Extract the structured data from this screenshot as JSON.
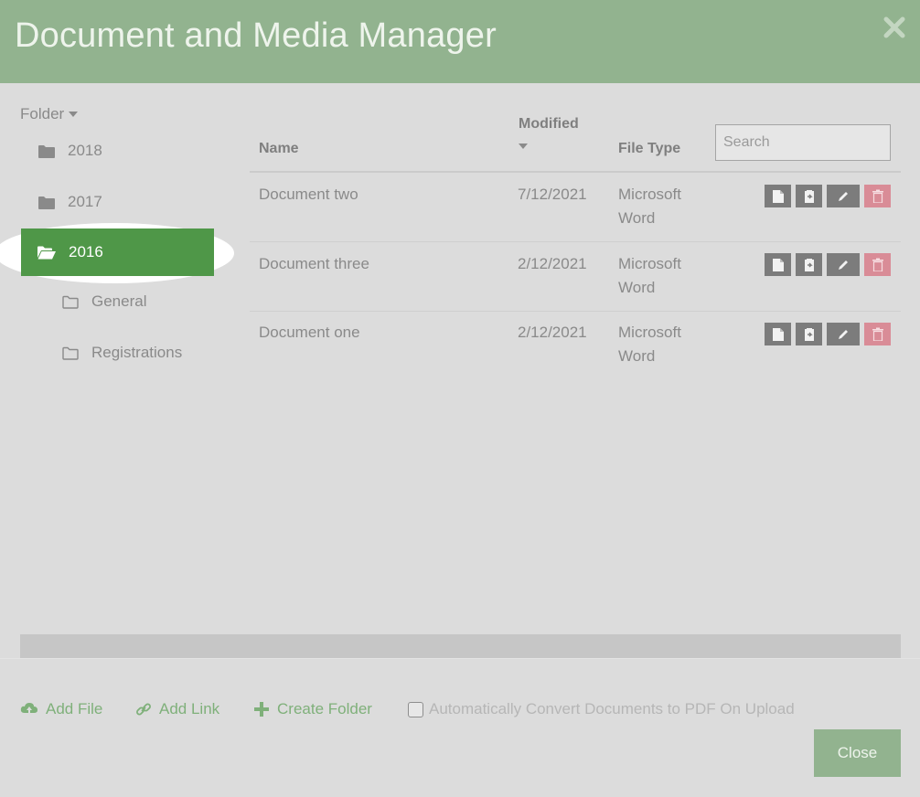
{
  "header": {
    "title": "Document and Media Manager"
  },
  "sidebar": {
    "dropdown_label": "Folder",
    "folders": [
      {
        "label": "2018"
      },
      {
        "label": "2017"
      },
      {
        "label": "2016"
      }
    ],
    "subfolders": [
      {
        "label": "General"
      },
      {
        "label": "Registrations"
      }
    ]
  },
  "table": {
    "headers": {
      "name": "Name",
      "modified": "Modified",
      "file_type": "File Type"
    },
    "search_placeholder": "Search",
    "rows": [
      {
        "name": "Document two",
        "modified": "7/12/2021",
        "type_line1": "Microsoft",
        "type_line2": "Word"
      },
      {
        "name": "Document three",
        "modified": "2/12/2021",
        "type_line1": "Microsoft",
        "type_line2": "Word"
      },
      {
        "name": "Document one",
        "modified": "2/12/2021",
        "type_line1": "Microsoft",
        "type_line2": "Word"
      }
    ]
  },
  "footer": {
    "add_file": "Add File",
    "add_link": "Add Link",
    "create_folder": "Create Folder",
    "auto_convert": "Automatically Convert Documents to PDF On Upload",
    "close": "Close"
  },
  "colors": {
    "header_bg": "#92b38f",
    "selected_folder": "#4f9748",
    "delete_button": "#d98c97",
    "action_button": "#7c7c7c",
    "footer_link": "#7fb07a"
  },
  "icons": [
    "close-icon",
    "folder-icon",
    "folder-open-icon",
    "folder-outline-icon",
    "file-icon",
    "clipboard-icon",
    "pencil-icon",
    "trash-icon",
    "cloud-upload-icon",
    "link-icon",
    "plus-icon"
  ]
}
